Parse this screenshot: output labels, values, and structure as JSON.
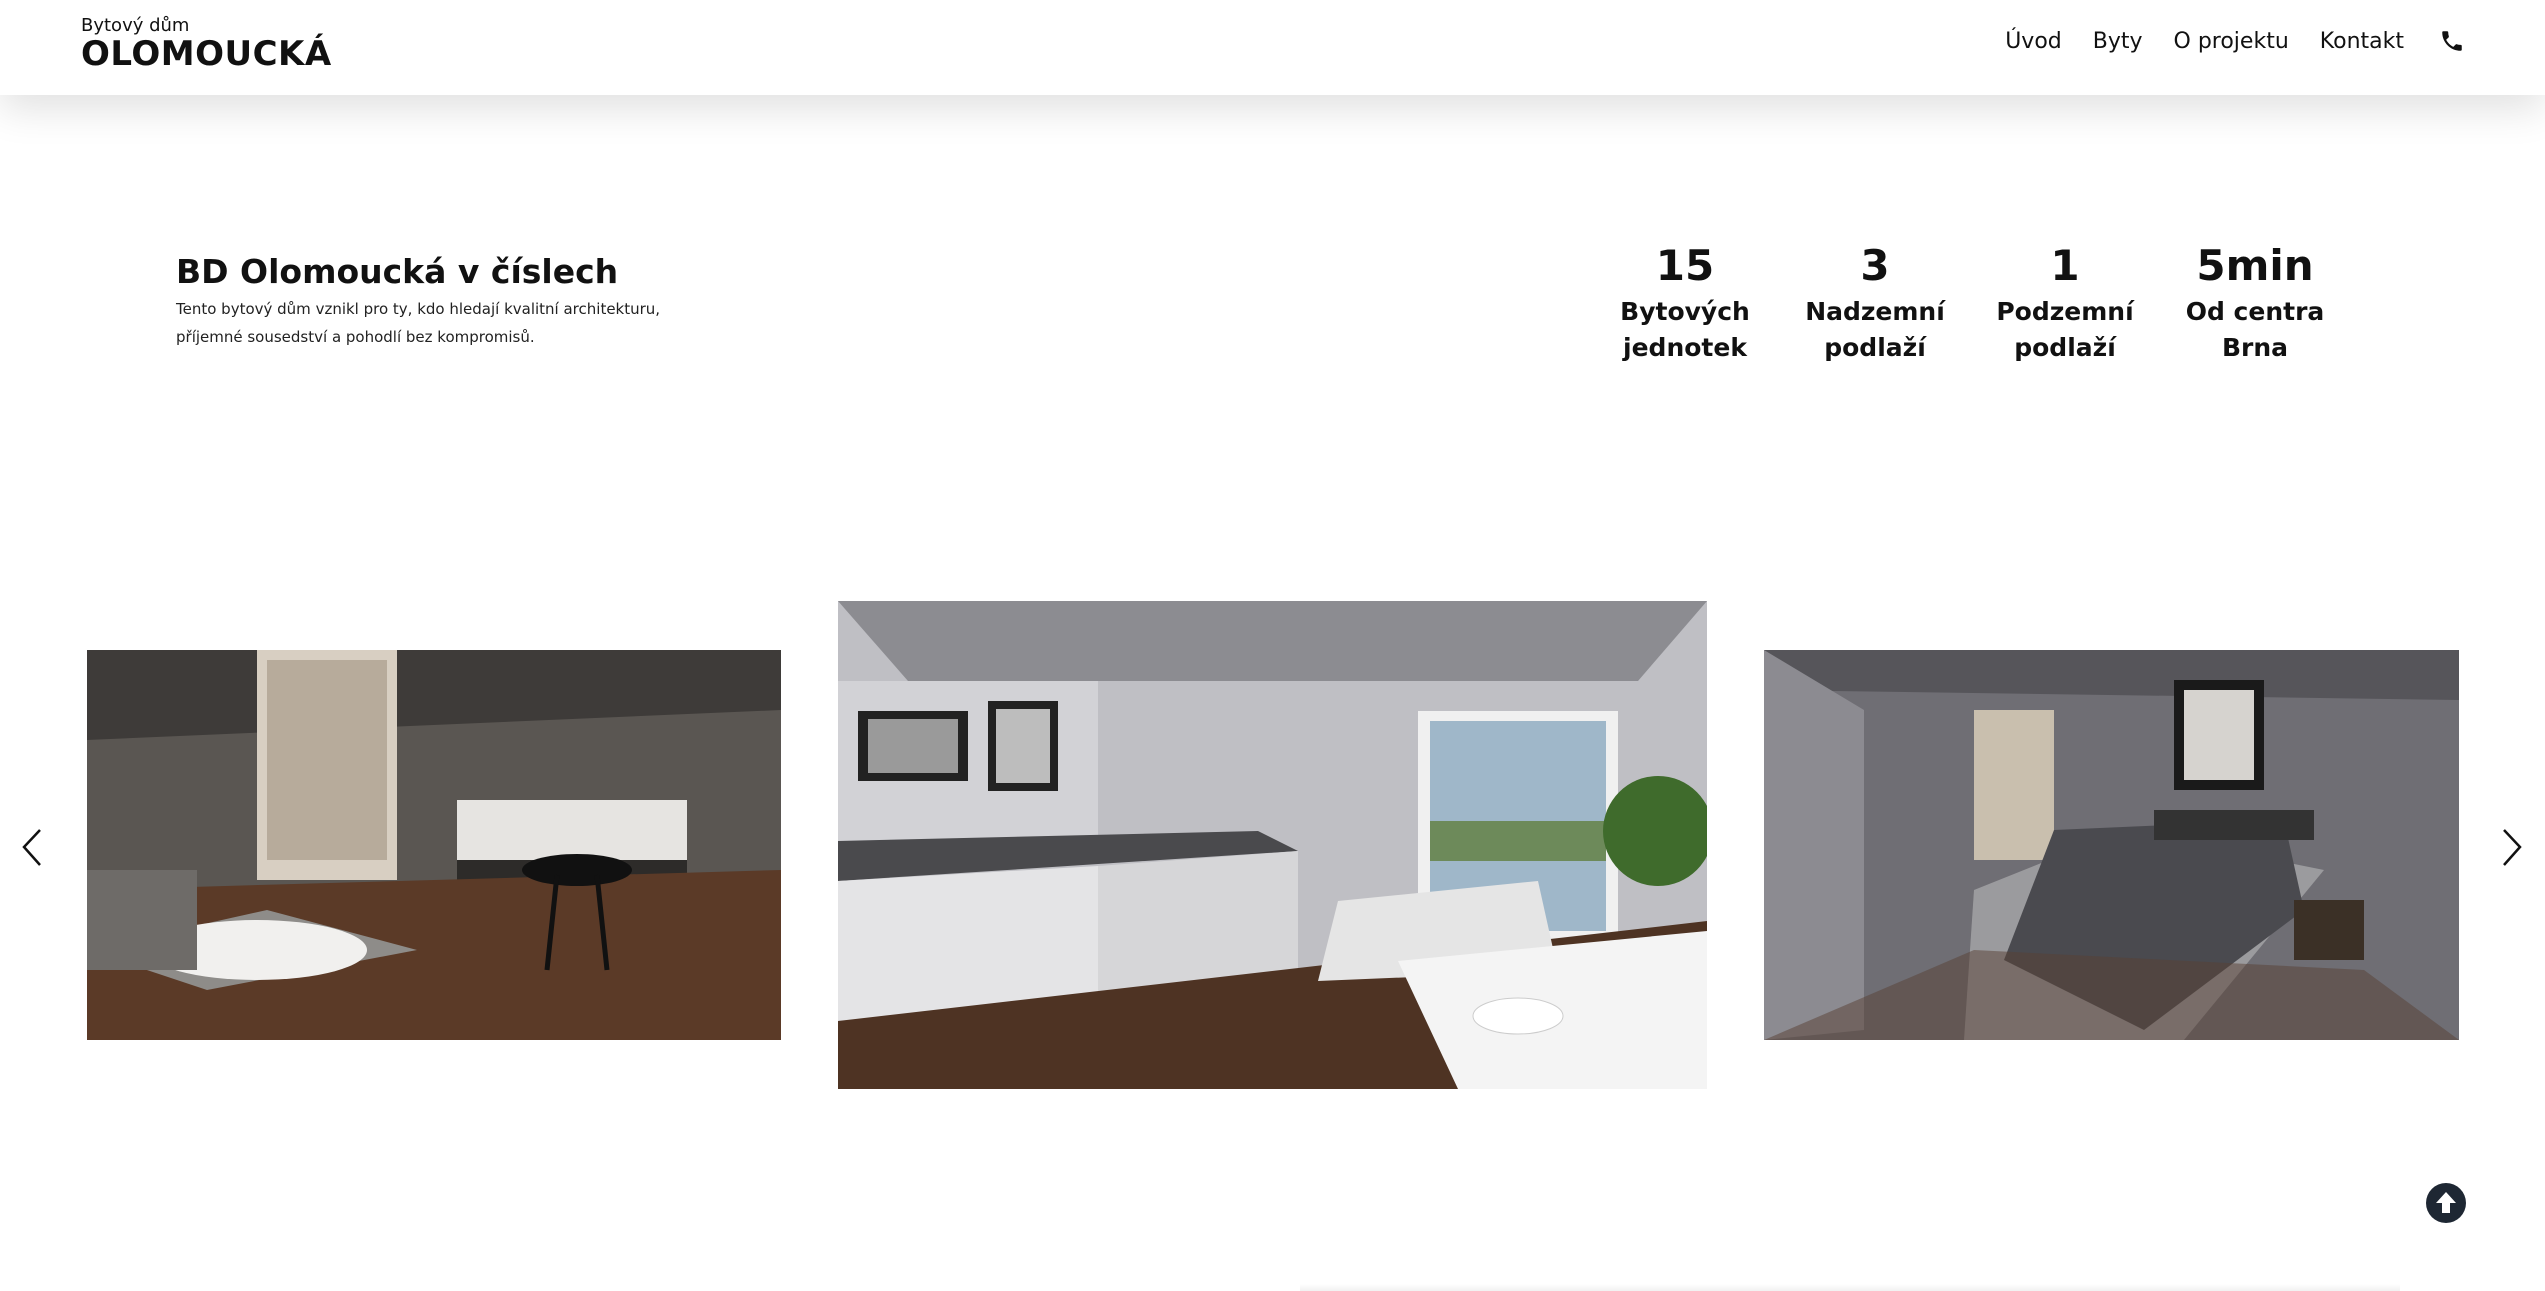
{
  "header": {
    "logo_small": "Bytový dům",
    "logo_big": "OLOMOUCKÁ",
    "nav": [
      "Úvod",
      "Byty",
      "O projektu",
      "Kontakt"
    ],
    "phone_icon": "phone-icon"
  },
  "intro": {
    "title": "BD Olomoucká v číslech",
    "text_line1": "Tento bytový dům vznikl pro ty, kdo hledají kvalitní architekturu,",
    "text_line2": "příjemné sousedství a pohodlí bez kompromisů."
  },
  "stats": [
    {
      "number": "15",
      "label": "Bytových\njednotek"
    },
    {
      "number": "3",
      "label": "Nadzemní\npodlaží"
    },
    {
      "number": "1",
      "label": "Podzemní\npodlaží"
    },
    {
      "number": "5min",
      "label": "Od centra\nBrna"
    }
  ],
  "carousel": {
    "prev_icon": "chevron-left-icon",
    "next_icon": "chevron-right-icon",
    "slides": [
      "living-kitchen-render",
      "kitchen-living-window-render",
      "bedroom-render"
    ]
  },
  "back_to_top_icon": "arrow-up-circle-icon"
}
